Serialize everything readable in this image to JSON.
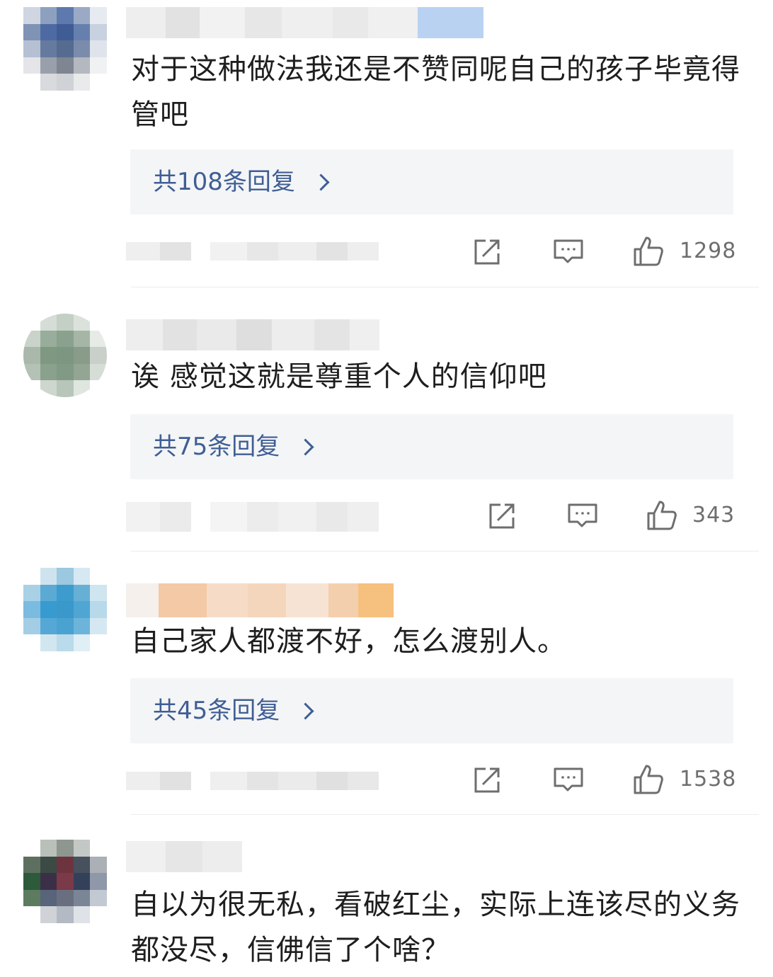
{
  "comments": [
    {
      "text": "对于这种做法我还是不赞同呢自己的孩子毕竟得管吧",
      "reply_label": "共108条回复",
      "likes": "1298",
      "icons": [
        "share-icon",
        "comment-icon",
        "thumbs-up-icon"
      ]
    },
    {
      "text": "诶  感觉这就是尊重个人的信仰吧",
      "reply_label": "共75条回复",
      "likes": "343",
      "icons": [
        "share-icon",
        "comment-icon",
        "thumbs-up-icon"
      ]
    },
    {
      "text": "自己家人都渡不好，怎么渡别人。",
      "reply_label": "共45条回复",
      "likes": "1538",
      "icons": [
        "share-icon",
        "comment-icon",
        "thumbs-up-icon"
      ]
    },
    {
      "text": "自以为很无私，看破红尘，实际上连该尽的义务都没尽，信佛信了个啥？"
    }
  ],
  "colors": {
    "reply_link": "#3f5e94",
    "reply_bg": "#f4f5f7",
    "icon": "#6e6e6e"
  }
}
